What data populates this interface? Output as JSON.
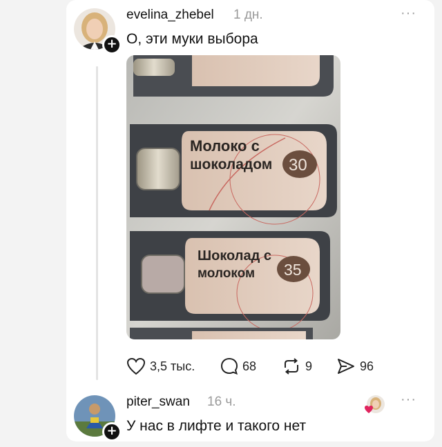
{
  "post": {
    "username": "evelina_zhebel",
    "time": "1 дн.",
    "text": "О, эти муки выбора",
    "photo_buttons": [
      {
        "line1": "Молоко с",
        "line2": "шоколадом",
        "price": "30"
      },
      {
        "line1": "Шоколад с",
        "line2": "молоком",
        "price": "35"
      }
    ],
    "actions": {
      "likes": "3,5 тыс.",
      "comments": "68",
      "reposts": "9",
      "shares": "96"
    }
  },
  "reply": {
    "username": "piter_swan",
    "time": "16 ч.",
    "text": "У нас в лифте и такого нет"
  },
  "icons": {
    "more": "more-dots-icon",
    "follow": "plus-icon",
    "like": "heart-icon",
    "comment": "comment-icon",
    "repost": "repost-icon",
    "share": "share-icon"
  },
  "colors": {
    "accent_like": "#e0245e",
    "muted": "#9a9a9a"
  }
}
